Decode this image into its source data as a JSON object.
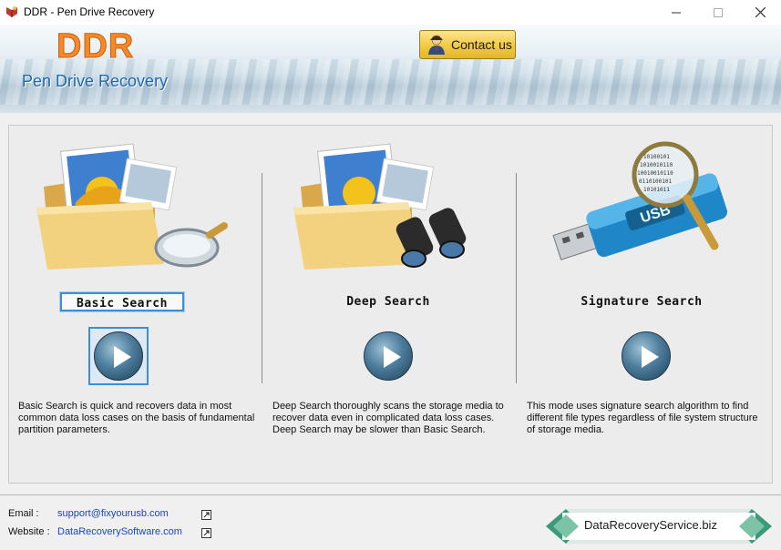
{
  "window": {
    "title": "DDR - Pen Drive Recovery"
  },
  "header": {
    "logo": "DDR",
    "app_name": "Pen Drive Recovery",
    "contact_label": "Contact us"
  },
  "modes": [
    {
      "title": "Basic Search",
      "description": "Basic Search is quick and recovers data in most common data loss cases on the basis of fundamental partition parameters.",
      "icon": "folder-magnifier-icon",
      "selected": true
    },
    {
      "title": "Deep Search",
      "description": "Deep Search thoroughly scans the storage media to recover data even in complicated data loss cases. Deep Search may be slower than Basic Search.",
      "icon": "folder-binoculars-icon",
      "selected": false
    },
    {
      "title": "Signature Search",
      "description": "This mode uses signature search algorithm to find different file types regardless of file system structure of storage media.",
      "icon": "usb-magnifier-icon",
      "selected": false
    }
  ],
  "footer": {
    "email_label": "Email :",
    "email": "support@fixyourusb.com",
    "website_label": "Website :",
    "website": "DataRecoverySoftware.com",
    "badge": "DataRecoveryService.biz"
  },
  "usb_label": "USB",
  "colors": {
    "accent": "#3d8ed8",
    "logo": "#f28a2a",
    "app_name": "#1c68b0",
    "link": "#1a44c9"
  }
}
